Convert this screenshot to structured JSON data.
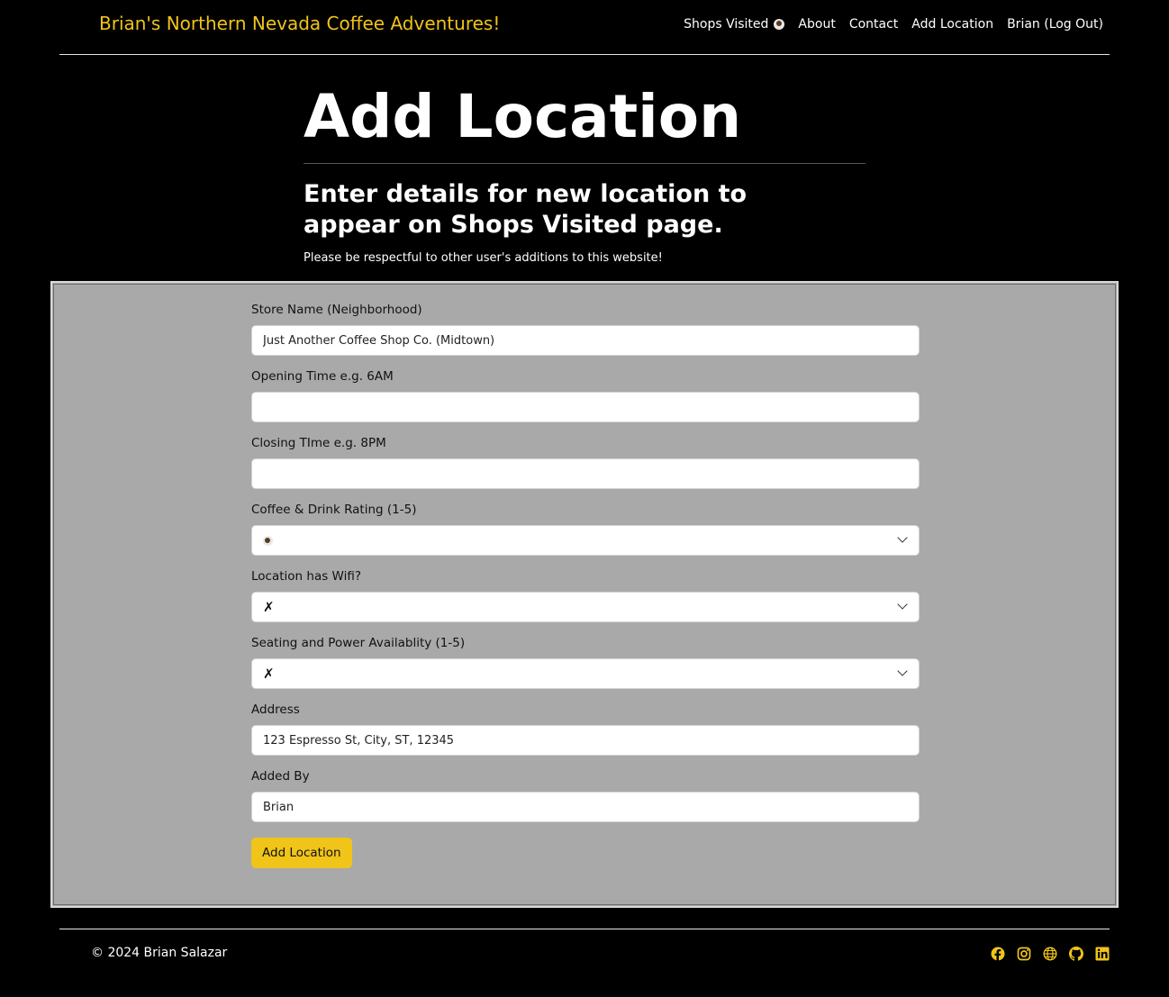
{
  "header": {
    "brand": "Brian's Northern Nevada Coffee Adventures!",
    "nav": {
      "shops_visited": "Shops Visited",
      "about": "About",
      "contact": "Contact",
      "add_location": "Add Location",
      "account": "Brian (Log Out)"
    }
  },
  "hero": {
    "title": "Add Location",
    "subtitle": "Enter details for new location to appear on Shops Visited page.",
    "note": "Please be respectful to other user's additions to this website!"
  },
  "form": {
    "store_name": {
      "label": "Store Name (Neighborhood)",
      "value": "Just Another Coffee Shop Co. (Midtown)"
    },
    "opening_time": {
      "label": "Opening Time e.g. 6AM",
      "value": ""
    },
    "closing_time": {
      "label": "Closing TIme e.g. 8PM",
      "value": ""
    },
    "coffee_rating": {
      "label": "Coffee & Drink Rating (1-5)",
      "selected_icon": "coffee-cup-icon",
      "selected_value": 1
    },
    "wifi": {
      "label": "Location has Wifi?",
      "selected": "✗"
    },
    "seating": {
      "label": "Seating and Power Availablity (1-5)",
      "selected": "✗"
    },
    "address": {
      "label": "Address",
      "value": "123 Espresso St, City, ST, 12345"
    },
    "added_by": {
      "label": "Added By",
      "value": "Brian"
    },
    "submit_label": "Add Location"
  },
  "footer": {
    "copyright": "© 2024 Brian Salazar",
    "social_icons": [
      "facebook-icon",
      "instagram-icon",
      "globe-icon",
      "github-icon",
      "linkedin-icon"
    ]
  },
  "colors": {
    "accent": "#f0c419",
    "background": "#000000",
    "form_panel": "#a9a9a9"
  }
}
